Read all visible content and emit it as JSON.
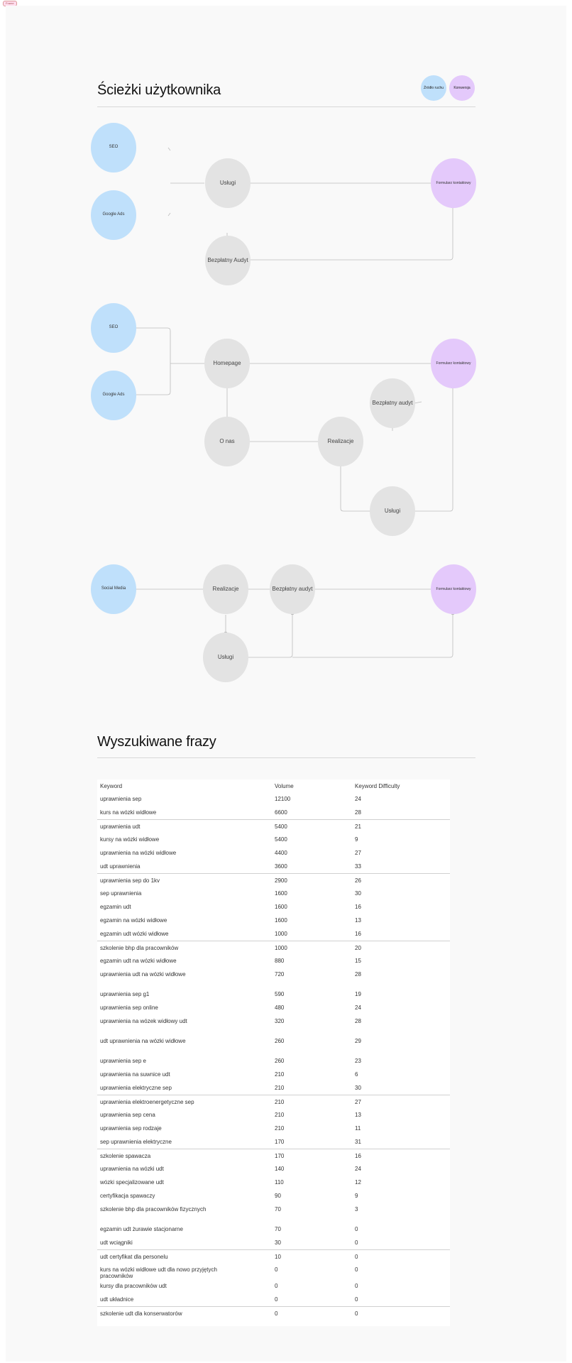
{
  "tag": "Frame",
  "paths_title": "Ścieżki użytkownika",
  "legend": {
    "source": "Źródło ruchu",
    "conversion": "Konwersja"
  },
  "path1": {
    "src_a": "SEO",
    "src_b": "Google Ads",
    "uslugi": "Usługi",
    "audyt": "Bezpłatny Audyt",
    "conv": "Formularz kontaktowy"
  },
  "path2": {
    "src_a": "SEO",
    "src_b": "Google Ads",
    "homepage": "Homepage",
    "o_nas": "O nas",
    "realizacje": "Realizacje",
    "audyt": "Bezpłatny audyt",
    "uslugi": "Usługi",
    "conv": "Formularz kontaktowy"
  },
  "path3": {
    "src": "Social Media",
    "realizacje": "Realizacje",
    "audyt": "Bezpłatny audyt",
    "uslugi": "Usługi",
    "conv": "Formularz kontaktowy"
  },
  "keywords_title": "Wyszukiwane frazy",
  "table": {
    "headers": [
      "Keyword",
      "Volume",
      "Keyword Difficulty"
    ],
    "rows": [
      [
        "uprawnienia sep",
        "12100",
        "24"
      ],
      [
        "kurs na wózki widłowe",
        "6600",
        "28"
      ],
      [
        "uprawnienia udt",
        "5400",
        "21"
      ],
      [
        "kursy na wózki widłowe",
        "5400",
        "9"
      ],
      [
        "uprawnienia na wózki widłowe",
        "4400",
        "27"
      ],
      [
        "udt uprawnienia",
        "3600",
        "33"
      ],
      [
        "uprawnienia sep do 1kv",
        "2900",
        "26"
      ],
      [
        "sep uprawnienia",
        "1600",
        "30"
      ],
      [
        "egzamin udt",
        "1600",
        "16"
      ],
      [
        "egzamin na wózki widłowe",
        "1600",
        "13"
      ],
      [
        "egzamin udt wózki widłowe",
        "1000",
        "16"
      ],
      [
        "szkolenie bhp dla pracowników",
        "1000",
        "20"
      ],
      [
        "egzamin udt na wózki widłowe",
        "880",
        "15"
      ],
      [
        "uprawnienia udt na wózki widłowe",
        "720",
        "28"
      ],
      [
        "uprawnienia sep g1",
        "590",
        "19"
      ],
      [
        "uprawnienia sep online",
        "480",
        "24"
      ],
      [
        "uprawnienia na wózek widłowy udt",
        "320",
        "28"
      ],
      [
        "udt uprawnienia na wózki widłowe",
        "260",
        "29"
      ],
      [
        "uprawnienia sep e",
        "260",
        "23"
      ],
      [
        "uprawnienia na suwnice udt",
        "210",
        "6"
      ],
      [
        "uprawnienia elektryczne sep",
        "210",
        "30"
      ],
      [
        "uprawnienia elektroenergetyczne sep",
        "210",
        "27"
      ],
      [
        "uprawnienia sep cena",
        "210",
        "13"
      ],
      [
        "uprawnienia sep rodzaje",
        "210",
        "11"
      ],
      [
        "sep uprawnienia elektryczne",
        "170",
        "31"
      ],
      [
        "szkolenie spawacza",
        "170",
        "16"
      ],
      [
        "uprawnienia na wózki udt",
        "140",
        "24"
      ],
      [
        "wózki specjalizowane udt",
        "110",
        "12"
      ],
      [
        "certyfikacja spawaczy",
        "90",
        "9"
      ],
      [
        "szkolenie bhp dla pracowników fizycznych",
        "70",
        "3"
      ],
      [
        "egzamin udt żurawie stacjonarne",
        "70",
        "0"
      ],
      [
        "udt wciągniki",
        "30",
        "0"
      ],
      [
        "udt certyfikat dla personelu",
        "10",
        "0"
      ],
      [
        "kurs na wózki widłowe udt dla nowo przyjętych pracowników",
        "0",
        "0"
      ],
      [
        "kursy dla pracowników udt",
        "0",
        "0"
      ],
      [
        "udt układnice",
        "0",
        "0"
      ],
      [
        "szkolenie udt dla konserwatorów",
        "0",
        "0"
      ]
    ]
  }
}
